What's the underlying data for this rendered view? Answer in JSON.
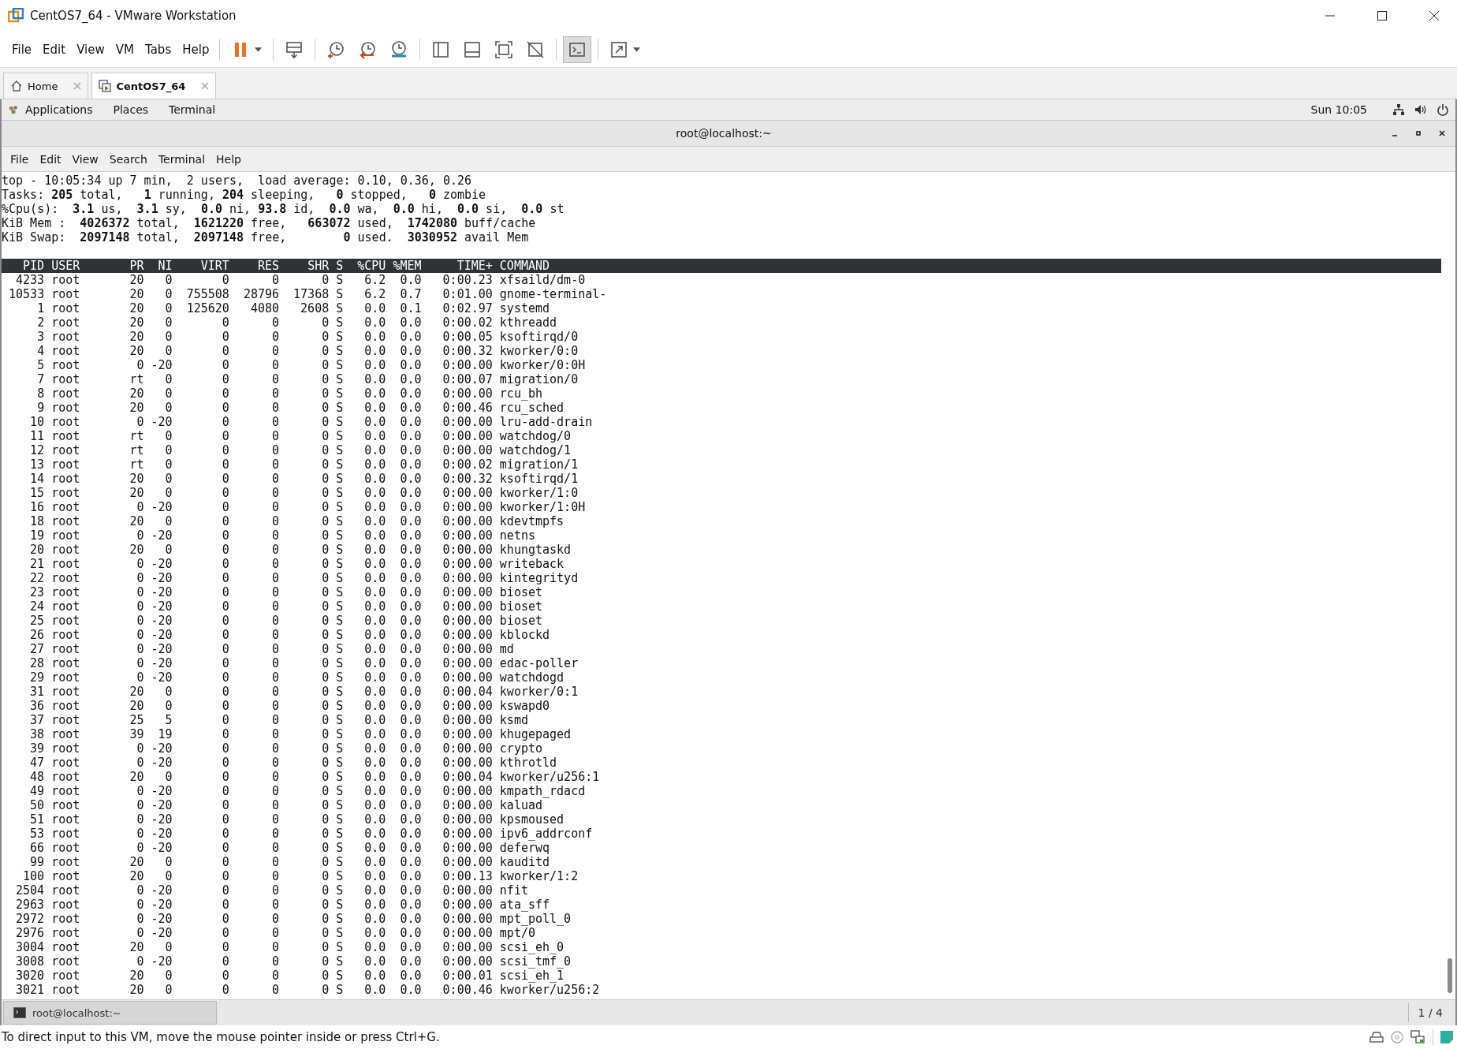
{
  "window": {
    "title": "CentOS7_64 - VMware Workstation"
  },
  "menu": [
    "File",
    "Edit",
    "View",
    "VM",
    "Tabs",
    "Help"
  ],
  "toolbar_groups": [
    {
      "buttons": [
        {
          "kind": "pause",
          "pressed": false,
          "dropdown": true
        }
      ]
    },
    {
      "buttons": [
        {
          "kind": "send-keys",
          "pressed": false,
          "dropdown": false
        }
      ]
    },
    {
      "buttons": [
        {
          "kind": "snapshot-take",
          "pressed": false,
          "dropdown": false
        },
        {
          "kind": "snapshot-revert",
          "pressed": false,
          "dropdown": false
        },
        {
          "kind": "snapshot-manager",
          "pressed": false,
          "dropdown": false
        }
      ]
    },
    {
      "buttons": [
        {
          "kind": "sidebar",
          "pressed": false,
          "dropdown": false
        },
        {
          "kind": "thumbnail-bar",
          "pressed": false,
          "dropdown": false
        },
        {
          "kind": "fullscreen",
          "pressed": false,
          "dropdown": false
        },
        {
          "kind": "unity",
          "pressed": false,
          "dropdown": false
        }
      ]
    },
    {
      "buttons": [
        {
          "kind": "console",
          "pressed": true,
          "dropdown": false
        }
      ]
    },
    {
      "buttons": [
        {
          "kind": "stretch",
          "pressed": false,
          "dropdown": true
        }
      ]
    }
  ],
  "tabs": [
    {
      "label": "Home",
      "kind": "home",
      "selected": false
    },
    {
      "label": "CentOS7_64",
      "kind": "vm",
      "selected": true
    }
  ],
  "gnome_bar": {
    "menus": [
      "Applications",
      "Places",
      "Terminal"
    ],
    "clock": "Sun 10:05"
  },
  "terminal": {
    "title": "root@localhost:~",
    "menu": [
      "File",
      "Edit",
      "View",
      "Search",
      "Terminal",
      "Help"
    ],
    "summary": [
      "top - 10:05:34 up 7 min,  2 users,  load average: 0.10, 0.36, 0.26",
      "Tasks: **205** total,   **1** running, **204** sleeping,   **0** stopped,   **0** zombie",
      "%Cpu(s):  **3.1** us,  **3.1** sy,  **0.0** ni, **93.8** id,  **0.0** wa,  **0.0** hi,  **0.0** si,  **0.0** st",
      "KiB Mem :  **4026372** total,  **1621220** free,   **663072** used,  **1742080** buff/cache",
      "KiB Swap:  **2097148** total,  **2097148** free,        **0** used.  **3030952** avail Mem"
    ],
    "table": {
      "columns": [
        "PID",
        "USER",
        "PR",
        "NI",
        "VIRT",
        "RES",
        "SHR",
        "S",
        "%CPU",
        "%MEM",
        "TIME+",
        "COMMAND"
      ],
      "rows": [
        [
          "4233",
          "root",
          "20",
          "0",
          "0",
          "0",
          "0",
          "S",
          "6.2",
          "0.0",
          "0:00.23",
          "xfsaild/dm-0"
        ],
        [
          "10533",
          "root",
          "20",
          "0",
          "755508",
          "28796",
          "17368",
          "S",
          "6.2",
          "0.7",
          "0:01.00",
          "gnome-terminal-"
        ],
        [
          "1",
          "root",
          "20",
          "0",
          "125620",
          "4080",
          "2608",
          "S",
          "0.0",
          "0.1",
          "0:02.97",
          "systemd"
        ],
        [
          "2",
          "root",
          "20",
          "0",
          "0",
          "0",
          "0",
          "S",
          "0.0",
          "0.0",
          "0:00.02",
          "kthreadd"
        ],
        [
          "3",
          "root",
          "20",
          "0",
          "0",
          "0",
          "0",
          "S",
          "0.0",
          "0.0",
          "0:00.05",
          "ksoftirqd/0"
        ],
        [
          "4",
          "root",
          "20",
          "0",
          "0",
          "0",
          "0",
          "S",
          "0.0",
          "0.0",
          "0:00.32",
          "kworker/0:0"
        ],
        [
          "5",
          "root",
          "0",
          "-20",
          "0",
          "0",
          "0",
          "S",
          "0.0",
          "0.0",
          "0:00.00",
          "kworker/0:0H"
        ],
        [
          "7",
          "root",
          "rt",
          "0",
          "0",
          "0",
          "0",
          "S",
          "0.0",
          "0.0",
          "0:00.07",
          "migration/0"
        ],
        [
          "8",
          "root",
          "20",
          "0",
          "0",
          "0",
          "0",
          "S",
          "0.0",
          "0.0",
          "0:00.00",
          "rcu_bh"
        ],
        [
          "9",
          "root",
          "20",
          "0",
          "0",
          "0",
          "0",
          "S",
          "0.0",
          "0.0",
          "0:00.46",
          "rcu_sched"
        ],
        [
          "10",
          "root",
          "0",
          "-20",
          "0",
          "0",
          "0",
          "S",
          "0.0",
          "0.0",
          "0:00.00",
          "lru-add-drain"
        ],
        [
          "11",
          "root",
          "rt",
          "0",
          "0",
          "0",
          "0",
          "S",
          "0.0",
          "0.0",
          "0:00.00",
          "watchdog/0"
        ],
        [
          "12",
          "root",
          "rt",
          "0",
          "0",
          "0",
          "0",
          "S",
          "0.0",
          "0.0",
          "0:00.00",
          "watchdog/1"
        ],
        [
          "13",
          "root",
          "rt",
          "0",
          "0",
          "0",
          "0",
          "S",
          "0.0",
          "0.0",
          "0:00.02",
          "migration/1"
        ],
        [
          "14",
          "root",
          "20",
          "0",
          "0",
          "0",
          "0",
          "S",
          "0.0",
          "0.0",
          "0:00.32",
          "ksoftirqd/1"
        ],
        [
          "15",
          "root",
          "20",
          "0",
          "0",
          "0",
          "0",
          "S",
          "0.0",
          "0.0",
          "0:00.00",
          "kworker/1:0"
        ],
        [
          "16",
          "root",
          "0",
          "-20",
          "0",
          "0",
          "0",
          "S",
          "0.0",
          "0.0",
          "0:00.00",
          "kworker/1:0H"
        ],
        [
          "18",
          "root",
          "20",
          "0",
          "0",
          "0",
          "0",
          "S",
          "0.0",
          "0.0",
          "0:00.00",
          "kdevtmpfs"
        ],
        [
          "19",
          "root",
          "0",
          "-20",
          "0",
          "0",
          "0",
          "S",
          "0.0",
          "0.0",
          "0:00.00",
          "netns"
        ],
        [
          "20",
          "root",
          "20",
          "0",
          "0",
          "0",
          "0",
          "S",
          "0.0",
          "0.0",
          "0:00.00",
          "khungtaskd"
        ],
        [
          "21",
          "root",
          "0",
          "-20",
          "0",
          "0",
          "0",
          "S",
          "0.0",
          "0.0",
          "0:00.00",
          "writeback"
        ],
        [
          "22",
          "root",
          "0",
          "-20",
          "0",
          "0",
          "0",
          "S",
          "0.0",
          "0.0",
          "0:00.00",
          "kintegrityd"
        ],
        [
          "23",
          "root",
          "0",
          "-20",
          "0",
          "0",
          "0",
          "S",
          "0.0",
          "0.0",
          "0:00.00",
          "bioset"
        ],
        [
          "24",
          "root",
          "0",
          "-20",
          "0",
          "0",
          "0",
          "S",
          "0.0",
          "0.0",
          "0:00.00",
          "bioset"
        ],
        [
          "25",
          "root",
          "0",
          "-20",
          "0",
          "0",
          "0",
          "S",
          "0.0",
          "0.0",
          "0:00.00",
          "bioset"
        ],
        [
          "26",
          "root",
          "0",
          "-20",
          "0",
          "0",
          "0",
          "S",
          "0.0",
          "0.0",
          "0:00.00",
          "kblockd"
        ],
        [
          "27",
          "root",
          "0",
          "-20",
          "0",
          "0",
          "0",
          "S",
          "0.0",
          "0.0",
          "0:00.00",
          "md"
        ],
        [
          "28",
          "root",
          "0",
          "-20",
          "0",
          "0",
          "0",
          "S",
          "0.0",
          "0.0",
          "0:00.00",
          "edac-poller"
        ],
        [
          "29",
          "root",
          "0",
          "-20",
          "0",
          "0",
          "0",
          "S",
          "0.0",
          "0.0",
          "0:00.00",
          "watchdogd"
        ],
        [
          "31",
          "root",
          "20",
          "0",
          "0",
          "0",
          "0",
          "S",
          "0.0",
          "0.0",
          "0:00.04",
          "kworker/0:1"
        ],
        [
          "36",
          "root",
          "20",
          "0",
          "0",
          "0",
          "0",
          "S",
          "0.0",
          "0.0",
          "0:00.00",
          "kswapd0"
        ],
        [
          "37",
          "root",
          "25",
          "5",
          "0",
          "0",
          "0",
          "S",
          "0.0",
          "0.0",
          "0:00.00",
          "ksmd"
        ],
        [
          "38",
          "root",
          "39",
          "19",
          "0",
          "0",
          "0",
          "S",
          "0.0",
          "0.0",
          "0:00.00",
          "khugepaged"
        ],
        [
          "39",
          "root",
          "0",
          "-20",
          "0",
          "0",
          "0",
          "S",
          "0.0",
          "0.0",
          "0:00.00",
          "crypto"
        ],
        [
          "47",
          "root",
          "0",
          "-20",
          "0",
          "0",
          "0",
          "S",
          "0.0",
          "0.0",
          "0:00.00",
          "kthrotld"
        ],
        [
          "48",
          "root",
          "20",
          "0",
          "0",
          "0",
          "0",
          "S",
          "0.0",
          "0.0",
          "0:00.04",
          "kworker/u256:1"
        ],
        [
          "49",
          "root",
          "0",
          "-20",
          "0",
          "0",
          "0",
          "S",
          "0.0",
          "0.0",
          "0:00.00",
          "kmpath_rdacd"
        ],
        [
          "50",
          "root",
          "0",
          "-20",
          "0",
          "0",
          "0",
          "S",
          "0.0",
          "0.0",
          "0:00.00",
          "kaluad"
        ],
        [
          "51",
          "root",
          "0",
          "-20",
          "0",
          "0",
          "0",
          "S",
          "0.0",
          "0.0",
          "0:00.00",
          "kpsmoused"
        ],
        [
          "53",
          "root",
          "0",
          "-20",
          "0",
          "0",
          "0",
          "S",
          "0.0",
          "0.0",
          "0:00.00",
          "ipv6_addrconf"
        ],
        [
          "66",
          "root",
          "0",
          "-20",
          "0",
          "0",
          "0",
          "S",
          "0.0",
          "0.0",
          "0:00.00",
          "deferwq"
        ],
        [
          "99",
          "root",
          "20",
          "0",
          "0",
          "0",
          "0",
          "S",
          "0.0",
          "0.0",
          "0:00.00",
          "kauditd"
        ],
        [
          "100",
          "root",
          "20",
          "0",
          "0",
          "0",
          "0",
          "S",
          "0.0",
          "0.0",
          "0:00.13",
          "kworker/1:2"
        ],
        [
          "2504",
          "root",
          "0",
          "-20",
          "0",
          "0",
          "0",
          "S",
          "0.0",
          "0.0",
          "0:00.00",
          "nfit"
        ],
        [
          "2963",
          "root",
          "0",
          "-20",
          "0",
          "0",
          "0",
          "S",
          "0.0",
          "0.0",
          "0:00.00",
          "ata_sff"
        ],
        [
          "2972",
          "root",
          "0",
          "-20",
          "0",
          "0",
          "0",
          "S",
          "0.0",
          "0.0",
          "0:00.00",
          "mpt_poll_0"
        ],
        [
          "2976",
          "root",
          "0",
          "-20",
          "0",
          "0",
          "0",
          "S",
          "0.0",
          "0.0",
          "0:00.00",
          "mpt/0"
        ],
        [
          "3004",
          "root",
          "20",
          "0",
          "0",
          "0",
          "0",
          "S",
          "0.0",
          "0.0",
          "0:00.00",
          "scsi_eh_0"
        ],
        [
          "3008",
          "root",
          "0",
          "-20",
          "0",
          "0",
          "0",
          "S",
          "0.0",
          "0.0",
          "0:00.00",
          "scsi_tmf_0"
        ],
        [
          "3020",
          "root",
          "20",
          "0",
          "0",
          "0",
          "0",
          "S",
          "0.0",
          "0.0",
          "0:00.01",
          "scsi_eh_1"
        ],
        [
          "3021",
          "root",
          "20",
          "0",
          "0",
          "0",
          "0",
          "S",
          "0.0",
          "0.0",
          "0:00.46",
          "kworker/u256:2"
        ]
      ]
    }
  },
  "window_list": {
    "item": "root@localhost:~",
    "workspace": "1 / 4"
  },
  "status_bar": {
    "message": "To direct input to this VM, move the mouse pointer inside or press Ctrl+G."
  }
}
